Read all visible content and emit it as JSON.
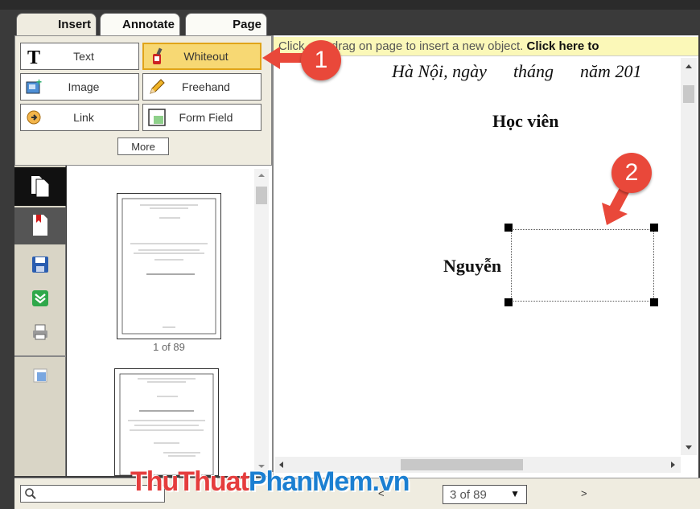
{
  "tabs": [
    {
      "label": "Insert"
    },
    {
      "label": "Annotate"
    },
    {
      "label": "Page"
    }
  ],
  "insert_panel": {
    "tools": [
      {
        "label": "Text",
        "icon": "text-t-icon"
      },
      {
        "label": "Whiteout",
        "icon": "whiteout-bottle-icon",
        "selected": true
      },
      {
        "label": "Image",
        "icon": "image-icon"
      },
      {
        "label": "Freehand",
        "icon": "pencil-icon"
      },
      {
        "label": "Link",
        "icon": "link-icon"
      },
      {
        "label": "Form Field",
        "icon": "form-field-icon"
      }
    ],
    "more_label": "More"
  },
  "sidebar": {
    "items": [
      "pages-icon",
      "bookmark-icon",
      "save-icon",
      "download-icon",
      "print-icon",
      "page-view-icon"
    ]
  },
  "thumbnails": {
    "first_label": "1 of 89"
  },
  "viewer": {
    "hint_prefix": "Click and drag on page to insert a new object.",
    "hint_link": "Click here to",
    "doc_date_line": "Hà Nội, ngày      tháng      năm 201",
    "doc_heading": "Học viên",
    "doc_name": "Nguyễn"
  },
  "bottom_bar": {
    "search_placeholder": "",
    "page_select_value": "3 of 89",
    "prev_label": "<",
    "next_label": ">"
  },
  "callouts": {
    "one": "1",
    "two": "2"
  },
  "watermark": {
    "part1": "ThuThuat",
    "part2": "PhanMem",
    "part3": ".vn"
  },
  "colors": {
    "accent_selected": "#f7d873",
    "callout": "#e9483a",
    "hint_bg": "#fbf8b8"
  }
}
